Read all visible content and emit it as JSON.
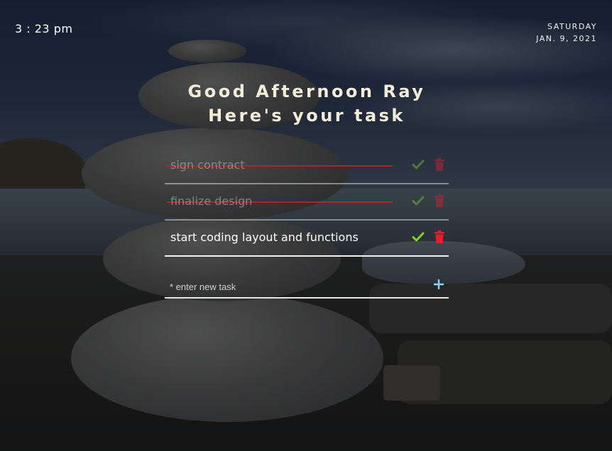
{
  "clock": {
    "time": "3 : 23 pm"
  },
  "date": {
    "weekday": "SATURDAY",
    "full": "JAN. 9, 2021"
  },
  "greeting": {
    "line1": "Good Afternoon Ray",
    "line2": "Here's your task"
  },
  "tasks": [
    {
      "text": "sign contract",
      "completed": true
    },
    {
      "text": "finalize design",
      "completed": true
    },
    {
      "text": "start coding layout and functions",
      "completed": false
    }
  ],
  "new_task": {
    "placeholder": "* enter new task"
  },
  "icons": {
    "complete": "check-icon",
    "delete": "trash-icon",
    "add": "plus-icon"
  },
  "colors": {
    "check": "#7ed321",
    "trash": "#e0202e",
    "add": "#8fd3ff",
    "strike": "#c81e28",
    "greeting": "#f3ecd9"
  }
}
